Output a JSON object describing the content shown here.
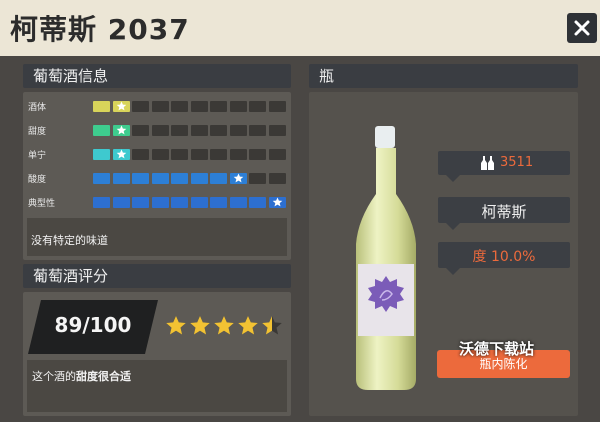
{
  "title": "柯蒂斯 2037",
  "left": {
    "info_header": "葡萄酒信息",
    "traits": [
      {
        "label": "酒体",
        "filled": 1,
        "color": "#d8d45a"
      },
      {
        "label": "甜度",
        "filled": 1,
        "color": "#3ecc8e"
      },
      {
        "label": "单宁",
        "filled": 1,
        "color": "#3ec9cf"
      },
      {
        "label": "酸度",
        "filled": 7,
        "color": "#2d7fd6"
      },
      {
        "label": "典型性",
        "filled": 9,
        "color": "#2d6fd0"
      }
    ],
    "flavor_text": "没有特定的味道",
    "rating_header": "葡萄酒评分",
    "score": "89/100",
    "star_rating": 4.5,
    "review_prefix": "这个酒的",
    "review_bold": "甜度很合适"
  },
  "right": {
    "header": "瓶",
    "count": "3511",
    "name": "柯蒂斯",
    "abv": "度 10.0%",
    "aging_button": "瓶内陈化"
  },
  "watermark": "沃德下载站",
  "colors": {
    "accent": "#ec6a3c",
    "star": "#f2c233"
  }
}
